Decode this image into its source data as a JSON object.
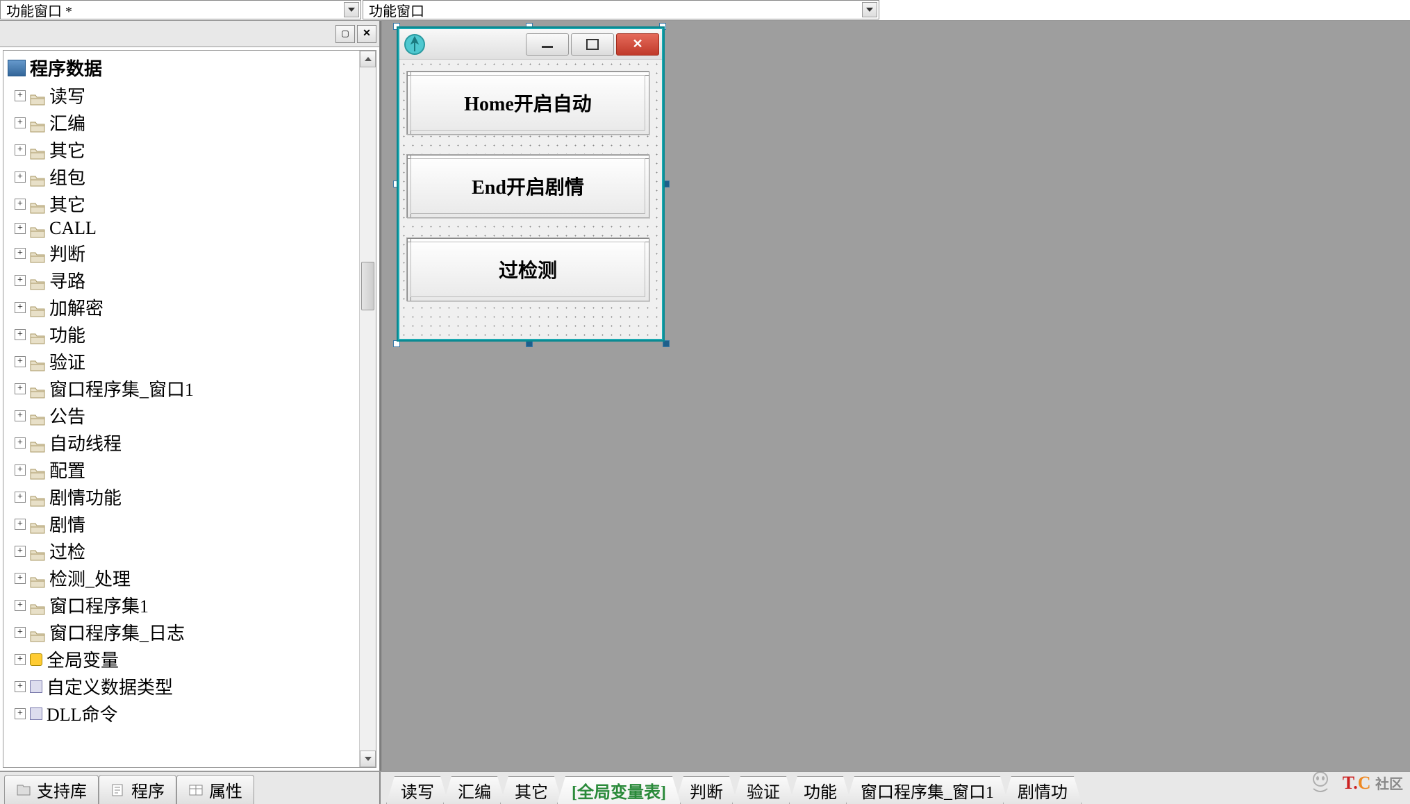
{
  "dropdowns": {
    "left": "功能窗口 *",
    "right": "功能窗口"
  },
  "tree": {
    "root": "程序数据",
    "items": [
      {
        "label": "读写",
        "icon": "folder"
      },
      {
        "label": "汇编",
        "icon": "folder"
      },
      {
        "label": "其它",
        "icon": "folder"
      },
      {
        "label": "组包",
        "icon": "folder"
      },
      {
        "label": "其它",
        "icon": "folder"
      },
      {
        "label": "CALL",
        "icon": "folder"
      },
      {
        "label": "判断",
        "icon": "folder"
      },
      {
        "label": "寻路",
        "icon": "folder"
      },
      {
        "label": "加解密",
        "icon": "folder"
      },
      {
        "label": "功能",
        "icon": "folder"
      },
      {
        "label": "验证",
        "icon": "folder"
      },
      {
        "label": "窗口程序集_窗口1",
        "icon": "folder"
      },
      {
        "label": "公告",
        "icon": "folder"
      },
      {
        "label": "自动线程",
        "icon": "folder"
      },
      {
        "label": "配置",
        "icon": "folder"
      },
      {
        "label": "剧情功能",
        "icon": "folder"
      },
      {
        "label": "剧情",
        "icon": "folder"
      },
      {
        "label": "过检",
        "icon": "folder"
      },
      {
        "label": "检测_处理",
        "icon": "folder"
      },
      {
        "label": "窗口程序集1",
        "icon": "folder"
      },
      {
        "label": "窗口程序集_日志",
        "icon": "folder"
      },
      {
        "label": "全局变量",
        "icon": "var"
      },
      {
        "label": "自定义数据类型",
        "icon": "type"
      },
      {
        "label": "DLL命令",
        "icon": "type"
      }
    ]
  },
  "design_window": {
    "buttons": [
      "Home开启自动",
      "End开启剧情",
      "过检测"
    ]
  },
  "bottom_left_tabs": [
    "支持库",
    "程序",
    "属性"
  ],
  "bottom_right_tabs": [
    {
      "label": "读写",
      "active": false
    },
    {
      "label": "汇编",
      "active": false
    },
    {
      "label": "其它",
      "active": false
    },
    {
      "label": "[全局变量表]",
      "active": true
    },
    {
      "label": "判断",
      "active": false
    },
    {
      "label": "验证",
      "active": false
    },
    {
      "label": "功能",
      "active": false
    },
    {
      "label": "窗口程序集_窗口1",
      "active": false
    },
    {
      "label": "剧情功",
      "active": false
    }
  ],
  "watermark": {
    "brand_t": "T",
    "brand_c": "C",
    "brand_txt": "社区"
  }
}
